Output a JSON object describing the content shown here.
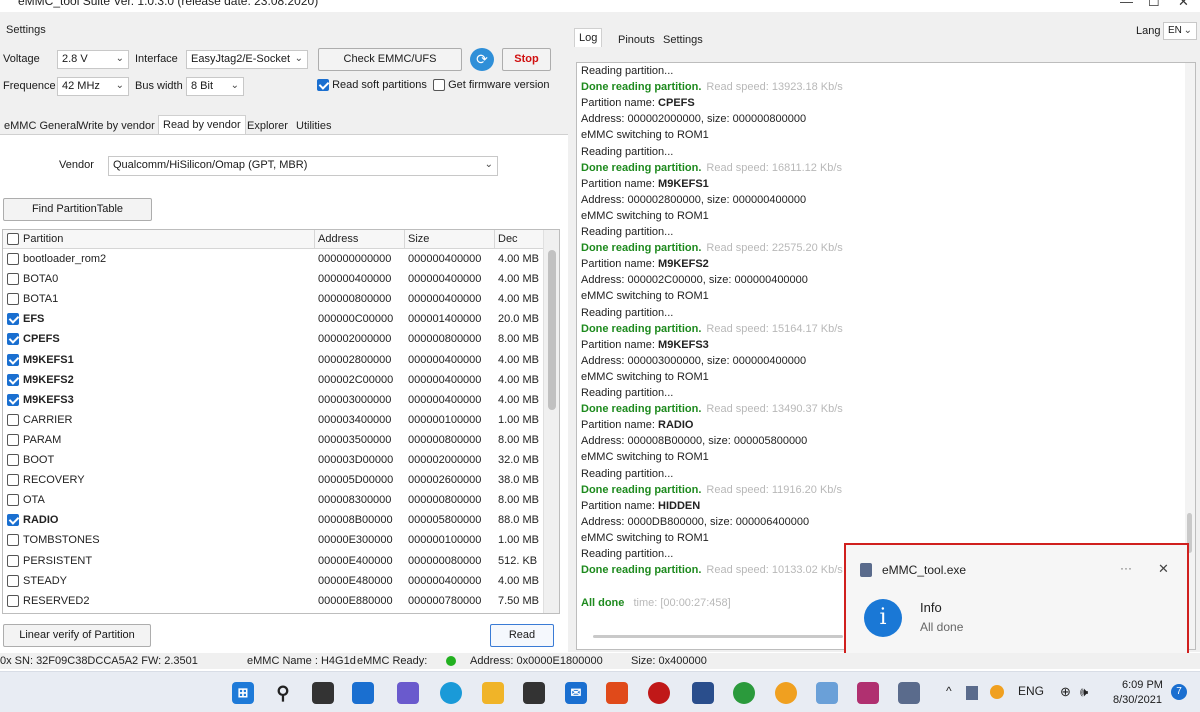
{
  "window": {
    "title": "eMMC_tool Suite  Ver. 1.0.3.0 (release date: 23.08.2020)",
    "min": "—",
    "max": "☐",
    "close": "✕"
  },
  "settings": {
    "group_label": "Settings",
    "voltage_label": "Voltage",
    "voltage_value": "2.8 V",
    "interface_label": "Interface",
    "interface_value": "EasyJtag2/E-Socket",
    "check_button": "Check EMMC/UFS",
    "stop_button": "Stop",
    "frequence_label": "Frequence",
    "frequence_value": "42 MHz",
    "buswidth_label": "Bus width",
    "buswidth_value": "8 Bit",
    "read_soft_label": "Read soft partitions",
    "get_firmware_label": "Get firmware version"
  },
  "left_tabs": [
    "eMMC General",
    "Write by vendor",
    "Read by vendor",
    "Explorer",
    "Utilities"
  ],
  "vendor": {
    "label": "Vendor",
    "value": "Qualcomm/HiSilicon/Omap (GPT, MBR)"
  },
  "find_button": "Find PartitionTable",
  "table": {
    "headers": [
      "Partition",
      "Address",
      "Size",
      "Dec"
    ],
    "rows": [
      {
        "name": "bootloader_rom2",
        "address": "000000000000",
        "size": "000000400000",
        "dec": "4.00 MB",
        "checked": false
      },
      {
        "name": "BOTA0",
        "address": "000000400000",
        "size": "000000400000",
        "dec": "4.00 MB",
        "checked": false
      },
      {
        "name": "BOTA1",
        "address": "000000800000",
        "size": "000000400000",
        "dec": "4.00 MB",
        "checked": false
      },
      {
        "name": "EFS",
        "address": "000000C00000",
        "size": "000001400000",
        "dec": "20.0 MB",
        "checked": true
      },
      {
        "name": "CPEFS",
        "address": "000002000000",
        "size": "000000800000",
        "dec": "8.00 MB",
        "checked": true
      },
      {
        "name": "M9KEFS1",
        "address": "000002800000",
        "size": "000000400000",
        "dec": "4.00 MB",
        "checked": true
      },
      {
        "name": "M9KEFS2",
        "address": "000002C00000",
        "size": "000000400000",
        "dec": "4.00 MB",
        "checked": true
      },
      {
        "name": "M9KEFS3",
        "address": "000003000000",
        "size": "000000400000",
        "dec": "4.00 MB",
        "checked": true
      },
      {
        "name": "CARRIER",
        "address": "000003400000",
        "size": "000000100000",
        "dec": "1.00 MB",
        "checked": false
      },
      {
        "name": "PARAM",
        "address": "000003500000",
        "size": "000000800000",
        "dec": "8.00 MB",
        "checked": false
      },
      {
        "name": "BOOT",
        "address": "000003D00000",
        "size": "000002000000",
        "dec": "32.0 MB",
        "checked": false
      },
      {
        "name": "RECOVERY",
        "address": "000005D00000",
        "size": "000002600000",
        "dec": "38.0 MB",
        "checked": false
      },
      {
        "name": "OTA",
        "address": "000008300000",
        "size": "000000800000",
        "dec": "8.00 MB",
        "checked": false
      },
      {
        "name": "RADIO",
        "address": "000008B00000",
        "size": "000005800000",
        "dec": "88.0 MB",
        "checked": true
      },
      {
        "name": "TOMBSTONES",
        "address": "00000E300000",
        "size": "000000100000",
        "dec": "1.00 MB",
        "checked": false
      },
      {
        "name": "PERSISTENT",
        "address": "00000E400000",
        "size": "000000080000",
        "dec": "512. KB",
        "checked": false
      },
      {
        "name": "STEADY",
        "address": "00000E480000",
        "size": "000000400000",
        "dec": "4.00 MB",
        "checked": false
      },
      {
        "name": "RESERVED2",
        "address": "00000E880000",
        "size": "000000780000",
        "dec": "7.50 MB",
        "checked": false
      }
    ]
  },
  "bottom_buttons": {
    "linear_verify": "Linear verify of Partition",
    "read": "Read"
  },
  "right_tabs": [
    "Log",
    "Pinouts",
    "Settings"
  ],
  "lang": {
    "label": "Lang",
    "value": "EN"
  },
  "log": [
    {
      "t": "plain",
      "text": "Reading partition..."
    },
    {
      "t": "done",
      "text": "Done reading partition.",
      "speed": "Read speed: 13923.18 Kb/s"
    },
    {
      "t": "name",
      "prefix": "Partition name: ",
      "name": "CPEFS"
    },
    {
      "t": "plain",
      "text": "Address: 000002000000, size: 000000800000"
    },
    {
      "t": "plain",
      "text": "eMMC switching to ROM1"
    },
    {
      "t": "plain",
      "text": "Reading partition..."
    },
    {
      "t": "done",
      "text": "Done reading partition.",
      "speed": "Read speed: 16811.12 Kb/s"
    },
    {
      "t": "name",
      "prefix": "Partition name: ",
      "name": "M9KEFS1"
    },
    {
      "t": "plain",
      "text": "Address: 000002800000, size: 000000400000"
    },
    {
      "t": "plain",
      "text": "eMMC switching to ROM1"
    },
    {
      "t": "plain",
      "text": "Reading partition..."
    },
    {
      "t": "done",
      "text": "Done reading partition.",
      "speed": "Read speed: 22575.20 Kb/s"
    },
    {
      "t": "name",
      "prefix": "Partition name: ",
      "name": "M9KEFS2"
    },
    {
      "t": "plain",
      "text": "Address: 000002C00000, size: 000000400000"
    },
    {
      "t": "plain",
      "text": "eMMC switching to ROM1"
    },
    {
      "t": "plain",
      "text": "Reading partition..."
    },
    {
      "t": "done",
      "text": "Done reading partition.",
      "speed": "Read speed: 15164.17 Kb/s"
    },
    {
      "t": "name",
      "prefix": "Partition name: ",
      "name": "M9KEFS3"
    },
    {
      "t": "plain",
      "text": "Address: 000003000000, size: 000000400000"
    },
    {
      "t": "plain",
      "text": "eMMC switching to ROM1"
    },
    {
      "t": "plain",
      "text": "Reading partition..."
    },
    {
      "t": "done",
      "text": "Done reading partition.",
      "speed": "Read speed: 13490.37 Kb/s"
    },
    {
      "t": "name",
      "prefix": "Partition name: ",
      "name": "RADIO"
    },
    {
      "t": "plain",
      "text": "Address: 000008B00000, size: 000005800000"
    },
    {
      "t": "plain",
      "text": "eMMC switching to ROM1"
    },
    {
      "t": "plain",
      "text": "Reading partition..."
    },
    {
      "t": "done",
      "text": "Done reading partition.",
      "speed": "Read speed: 11916.20 Kb/s"
    },
    {
      "t": "name",
      "prefix": "Partition name: ",
      "name": "HIDDEN"
    },
    {
      "t": "plain",
      "text": "Address: 0000DB800000, size: 000006400000"
    },
    {
      "t": "plain",
      "text": "eMMC switching to ROM1"
    },
    {
      "t": "plain",
      "text": "Reading partition..."
    },
    {
      "t": "done",
      "text": "Done reading partition.",
      "speed": "Read speed: 10133.02 Kb/s"
    }
  ],
  "log_footer": {
    "text": "All done",
    "time": "time: [00:00:27:458]"
  },
  "toast": {
    "app": "eMMC_tool.exe",
    "more": "···",
    "close": "✕",
    "title": "Info",
    "message": "All done"
  },
  "status": {
    "sn": "0x SN: 32F09C38DCCA5A2  FW: 2.3501",
    "emmc_name": "eMMC Name : H4G1d",
    "emmc_ready": "eMMC Ready:",
    "address": "Address: 0x0000E1800000",
    "size": "Size: 0x400000"
  },
  "taskbar": {
    "tray_lang": "ENG",
    "time": "6:09 PM",
    "date": "8/30/2021",
    "badge": "7"
  }
}
